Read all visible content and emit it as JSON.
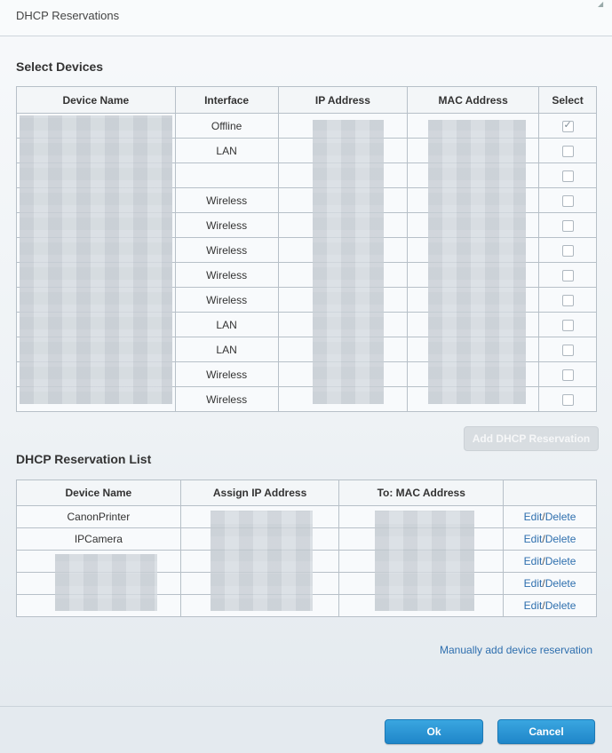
{
  "window": {
    "title": "DHCP Reservations"
  },
  "select_devices": {
    "title": "Select Devices",
    "headers": [
      "Device Name",
      "Interface",
      "IP Address",
      "MAC Address",
      "Select"
    ],
    "rows": [
      {
        "interface": "Offline",
        "checked": true
      },
      {
        "interface": "LAN",
        "checked": false
      },
      {
        "interface": "",
        "checked": false
      },
      {
        "interface": "Wireless",
        "checked": false
      },
      {
        "interface": "Wireless",
        "checked": false
      },
      {
        "interface": "Wireless",
        "checked": false
      },
      {
        "interface": "Wireless",
        "checked": false
      },
      {
        "interface": "Wireless",
        "checked": false
      },
      {
        "interface": "LAN",
        "checked": false
      },
      {
        "interface": "LAN",
        "checked": false
      },
      {
        "interface": "Wireless",
        "checked": false
      },
      {
        "interface": "Wireless",
        "checked": false
      }
    ]
  },
  "add_button": "Add DHCP Reservation",
  "reservation_list": {
    "title": "DHCP Reservation List",
    "headers": [
      "Device Name",
      "Assign IP Address",
      "To: MAC Address",
      ""
    ],
    "rows": [
      {
        "device": "CanonPrinter"
      },
      {
        "device": "IPCamera"
      },
      {
        "device": ""
      },
      {
        "device": ""
      },
      {
        "device": ""
      }
    ],
    "edit_label": "Edit",
    "separator": "/",
    "delete_label": "Delete"
  },
  "manual_link": "Manually add device reservation",
  "footer": {
    "ok": "Ok",
    "cancel": "Cancel"
  },
  "colors": {
    "accent": "#2e6fae",
    "button": "#1f86c9"
  }
}
